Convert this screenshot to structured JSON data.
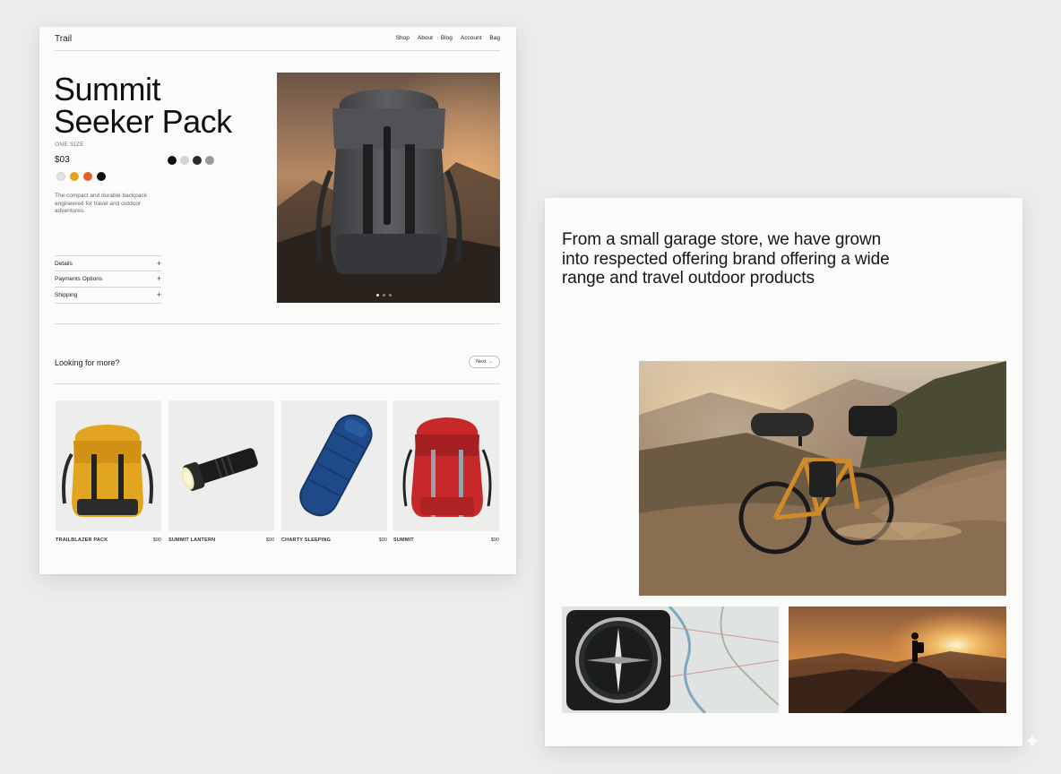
{
  "header": {
    "brand": "Trail",
    "nav": [
      "Shop",
      "About",
      "Blog",
      "Account",
      "Bag"
    ]
  },
  "product": {
    "title_line1": "Summit",
    "title_line2": "Seeker Pack",
    "size_label": "ONE SIZE",
    "price": "$03",
    "swatches_primary": [
      "#e4e4e2",
      "#e6a21e",
      "#e2642a",
      "#111111"
    ],
    "swatches_secondary": [
      "#111111",
      "#d4d4d2",
      "#2a2a2a",
      "#9a9a98"
    ],
    "description": "The compact and durable backpack engineered for travel and outdoor adventures.",
    "accordion": [
      {
        "label": "Details",
        "icon": "plus-icon"
      },
      {
        "label": "Payments Options",
        "icon": "plus-icon"
      },
      {
        "label": "Shipping",
        "icon": "plus-icon"
      }
    ]
  },
  "related": {
    "heading": "Looking for more?",
    "button_label": "Next",
    "button_icon": "arrow-right-icon",
    "items": [
      {
        "name": "TRAILBLAZER PACK",
        "price": "$90"
      },
      {
        "name": "SUMMIT LANTERN",
        "price": "$90"
      },
      {
        "name": "CHARTY SLEEPING",
        "price": "$90"
      },
      {
        "name": "SUMMIT",
        "price": "$90"
      }
    ]
  },
  "story": {
    "quote": "From a small garage store, we have grown into respected offering brand offering a wide range and travel outdoor products"
  }
}
